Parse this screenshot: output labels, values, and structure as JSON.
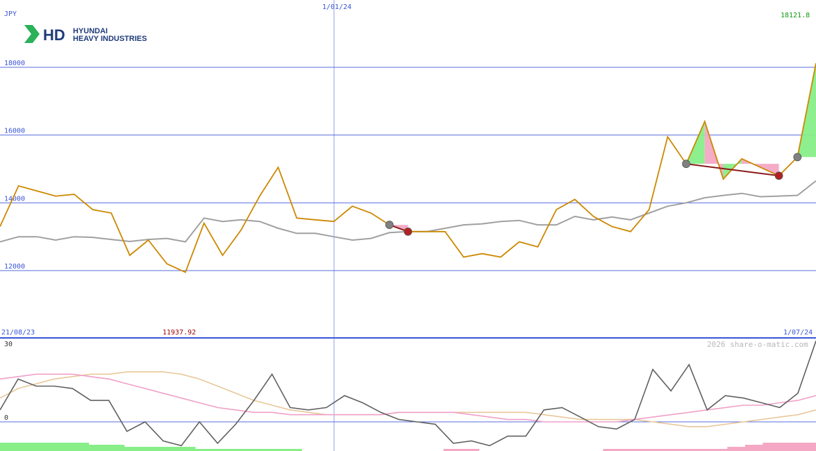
{
  "logo": {
    "mark": "HD",
    "line1": "HYUNDAI",
    "line2": "HEAVY INDUSTRIES",
    "color": "#1e3a7a",
    "accent": "#2bb15a"
  },
  "labels": {
    "currency": "JPY",
    "date_top": "1/01/24",
    "last_price": "18121.8",
    "date_start": "21/08/23",
    "low_price": "11937.92",
    "date_end": "1/07/24",
    "watermark": "2026 share-o-matic.com"
  },
  "colors": {
    "price": "#cc8800",
    "average": "#a0a0a0",
    "gridline": "#3a55d8",
    "osc_black": "#606060",
    "osc_pink": "#f0a0c8",
    "osc_tan": "#e8c89a",
    "up_fill": "#88ee88",
    "down_fill": "#f4a8c4",
    "last_price_color": "#119911",
    "low_price_color": "#990000"
  },
  "chart_data": [
    {
      "type": "line",
      "ylabel": "JPY",
      "ylim": [
        11000,
        19000
      ],
      "yticks": [
        12000,
        14000,
        16000,
        18000
      ],
      "x_ticks": [
        "21/08/23",
        "1/01/24",
        "1/07/24"
      ],
      "grid": true,
      "series": [
        {
          "role": "price",
          "values": [
            13300,
            14500,
            14350,
            14200,
            14250,
            13800,
            13700,
            12450,
            12900,
            12200,
            11950,
            13400,
            12450,
            13200,
            14200,
            15050,
            13550,
            13500,
            13450,
            13900,
            13700,
            13350,
            13150,
            13150,
            13150,
            12400,
            12500,
            12400,
            12850,
            12700,
            13800,
            14100,
            13600,
            13300,
            13150,
            13800,
            15950,
            15150,
            16400,
            14700,
            15300,
            15050,
            14800,
            15350,
            18121.8
          ]
        },
        {
          "role": "moving-average",
          "values": [
            12850,
            13000,
            13000,
            12900,
            13000,
            12980,
            12920,
            12860,
            12920,
            12950,
            12850,
            13550,
            13450,
            13500,
            13450,
            13250,
            13100,
            13100,
            13000,
            12900,
            12950,
            13120,
            13150,
            13150,
            13250,
            13350,
            13380,
            13450,
            13480,
            13350,
            13350,
            13600,
            13500,
            13580,
            13500,
            13700,
            13900,
            14000,
            14150,
            14220,
            14280,
            14180,
            14200,
            14220,
            14650
          ]
        }
      ],
      "annotations": [
        {
          "type": "up-marker",
          "index": 21,
          "value": 13350
        },
        {
          "type": "down-marker",
          "index": 22,
          "value": 13150
        },
        {
          "type": "up-marker",
          "index": 37,
          "value": 15150
        },
        {
          "type": "down-marker",
          "index": 42,
          "value": 14800
        },
        {
          "type": "up-marker",
          "index": 43,
          "value": 15350
        }
      ],
      "last_value": 18121.8,
      "min_value": 11937.92
    },
    {
      "type": "line",
      "ylim": [
        -10,
        30
      ],
      "yticks": [
        -10,
        0,
        30
      ],
      "series": [
        {
          "role": "oscillator",
          "values": [
            5,
            18,
            15,
            15,
            14,
            9,
            9,
            -4,
            0,
            -8,
            -10,
            0,
            -9,
            -1,
            9,
            20,
            6,
            5,
            6,
            11,
            8,
            4,
            1,
            0,
            -1,
            -9,
            -8,
            -10,
            -6,
            -6,
            5,
            6,
            2,
            -2,
            -3,
            1,
            22,
            13,
            24,
            5,
            11,
            10,
            8,
            6,
            12,
            34
          ]
        },
        {
          "role": "signal-fast",
          "values": [
            18,
            19,
            20,
            20,
            20,
            19,
            18,
            16,
            14,
            12,
            10,
            8,
            6,
            5,
            4,
            4,
            3,
            3,
            3,
            3,
            3,
            3,
            4,
            4,
            4,
            4,
            3,
            2,
            1,
            1,
            0,
            0,
            0,
            0,
            0,
            1,
            2,
            3,
            4,
            5,
            6,
            7,
            7,
            8,
            9,
            11
          ]
        },
        {
          "role": "signal-slow",
          "values": [
            10,
            14,
            16,
            18,
            19,
            20,
            20,
            21,
            21,
            21,
            20,
            18,
            15,
            12,
            9,
            7,
            5,
            4,
            3,
            3,
            3,
            3,
            4,
            4,
            4,
            4,
            4,
            4,
            4,
            4,
            3,
            2,
            1,
            1,
            1,
            1,
            0,
            -1,
            -2,
            -2,
            -1,
            0,
            1,
            2,
            3,
            5
          ]
        }
      ],
      "histogram": [
        4,
        4,
        4,
        4,
        4,
        3,
        3,
        2,
        2,
        2,
        2,
        1,
        1,
        1,
        1,
        1,
        1,
        0,
        0,
        0,
        0,
        0,
        0,
        0,
        0,
        -1,
        -1,
        0,
        0,
        0,
        0,
        0,
        0,
        0,
        -1,
        -1,
        -1,
        -1,
        -1,
        -1,
        -1,
        -2,
        -3,
        -4,
        -4,
        -4
      ]
    }
  ]
}
